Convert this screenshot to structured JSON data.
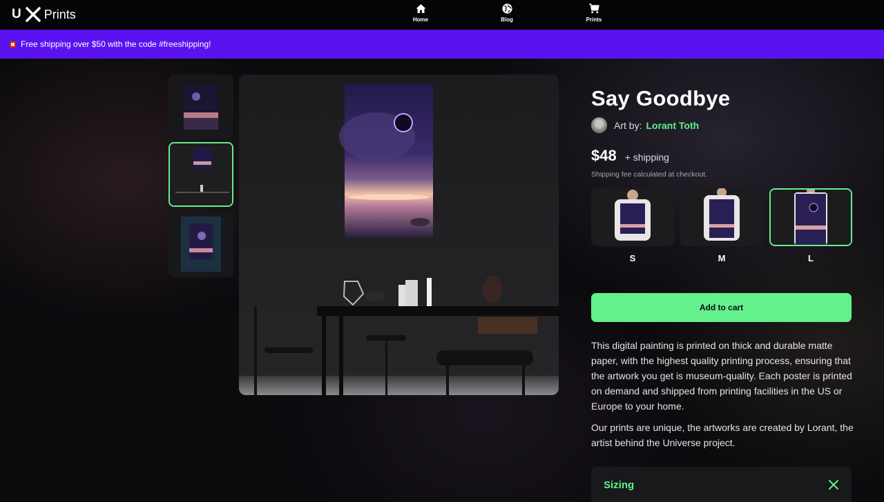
{
  "header": {
    "logo_mark": "U",
    "logo_text": "Prints",
    "nav": [
      {
        "label": "Home",
        "icon": "home-icon"
      },
      {
        "label": "Blog",
        "icon": "globe-icon"
      },
      {
        "label": "Prints",
        "icon": "cart-icon"
      }
    ]
  },
  "promo": {
    "text": "Free shipping over $50 with the code #freeshipping!"
  },
  "product": {
    "title": "Say Goodbye",
    "artist_label": "Art by:",
    "artist_name": "Lorant Toth",
    "price": "$48",
    "price_extra": "+ shipping",
    "shipping_note": "Shipping fee calculated at checkout.",
    "sizes": [
      {
        "label": "S",
        "selected": false
      },
      {
        "label": "M",
        "selected": false
      },
      {
        "label": "L",
        "selected": true
      }
    ],
    "add_to_cart": "Add to cart",
    "description": [
      "This digital painting is printed on thick and durable matte paper, with the highest quality printing process, ensuring that the artwork you get is museum-quality. Each poster is printed on demand and shipped from printing facilities in the US or Europe to your home.",
      "Our prints are unique, the artworks are created by Lorant, the artist behind the Universe project."
    ],
    "sizing_label": "Sizing"
  },
  "colors": {
    "accent": "#63f08d",
    "promo_bg": "#5b12f0",
    "background": "#0b0a0d"
  }
}
